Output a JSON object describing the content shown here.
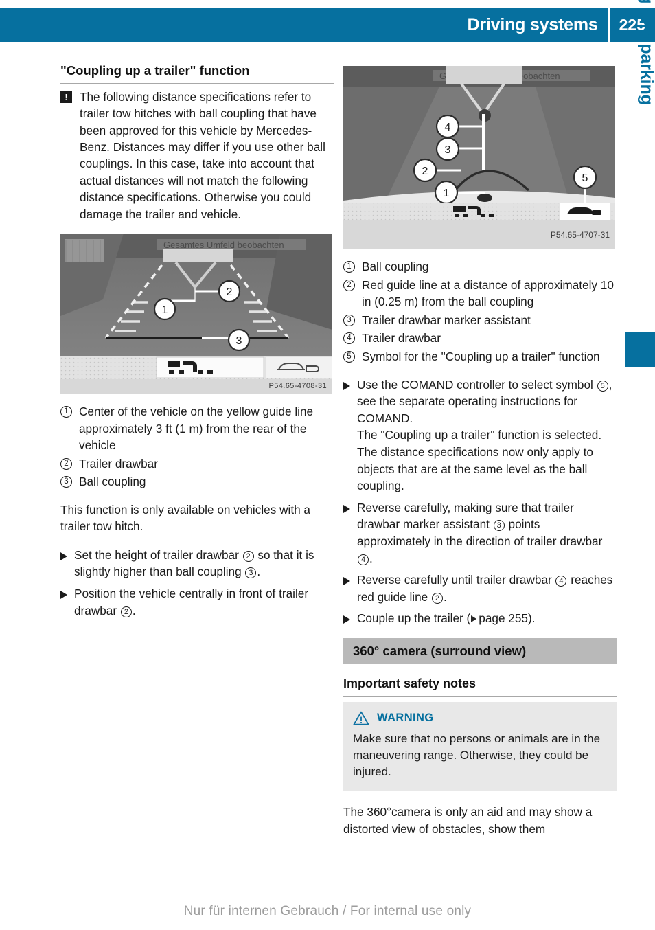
{
  "header": {
    "title": "Driving systems",
    "page_number": "225"
  },
  "side_tab": {
    "label": "Driving and parking"
  },
  "footer": {
    "watermark": "Nur für internen Gebrauch / For internal use only"
  },
  "left_column": {
    "heading": "\"Coupling up a trailer\" function",
    "note": {
      "icon": "exclamation-box-icon",
      "text": "The following distance specifications refer to trailer tow hitches with ball coupling that have been approved for this vehicle by Mercedes-Benz. Distances may differ if you use other ball couplings. In this case, take into account that actual distances will not match the following distance specifications. Otherwise you could damage the trailer and vehicle."
    },
    "figure": {
      "caption": "P54.65-4708-31",
      "callouts": [
        "1",
        "2",
        "3"
      ]
    },
    "legend": [
      {
        "num": "1",
        "text": "Center of the vehicle on the yellow guide line approximately 3 ft (1 m) from the rear of the vehicle"
      },
      {
        "num": "2",
        "text": "Trailer drawbar"
      },
      {
        "num": "3",
        "text": "Ball coupling"
      }
    ],
    "paragraph": "This function is only available on vehicles with a trailer tow hitch.",
    "actions": [
      {
        "parts": [
          "Set the height of trailer drawbar ",
          "2",
          " so that it is slightly higher than ball coupling ",
          "3",
          "."
        ]
      },
      {
        "parts": [
          "Position the vehicle centrally in front of trailer drawbar ",
          "2",
          "."
        ]
      }
    ]
  },
  "right_column": {
    "figure": {
      "caption": "P54.65-4707-31",
      "callouts": [
        "1",
        "2",
        "3",
        "4",
        "5"
      ]
    },
    "legend": [
      {
        "num": "1",
        "text": "Ball coupling"
      },
      {
        "num": "2",
        "text": "Red guide line at a distance of approximately 10 in (0.25 m) from the ball coupling"
      },
      {
        "num": "3",
        "text": "Trailer drawbar marker assistant"
      },
      {
        "num": "4",
        "text": "Trailer drawbar"
      },
      {
        "num": "5",
        "text": "Symbol for the \"Coupling up a trailer\" function"
      }
    ],
    "actions": [
      {
        "id": "action-comand",
        "text_before": "Use the COMAND controller to select symbol ",
        "ref": "5",
        "text_after": ", see the separate operating instructions for COMAND.",
        "followup": "The \"Coupling up a trailer\" function is selected. The distance specifications now only apply to objects that are at the same level as the ball coupling."
      },
      {
        "id": "action-reverse-marker",
        "text_before": "Reverse carefully, making sure that trailer drawbar marker assistant ",
        "ref": "3",
        "text_mid": " points approximately in the direction of trailer drawbar ",
        "ref2": "4",
        "text_after": "."
      },
      {
        "id": "action-reverse-until",
        "text_before": "Reverse carefully until trailer drawbar ",
        "ref": "4",
        "text_mid": " reaches red guide line ",
        "ref2": "2",
        "text_after": "."
      },
      {
        "id": "action-couple-up",
        "text_before": "Couple up the trailer (",
        "xref": "page 255",
        "text_after": ")."
      }
    ],
    "section": {
      "band_heading": "360° camera (surround view)",
      "minor_heading": "Important safety notes",
      "warning": {
        "icon": "warning-triangle-icon",
        "label": "WARNING",
        "body": "Make sure that no persons or animals are in the maneuvering range. Otherwise, they could be injured."
      },
      "closing_paragraph": "The 360°camera is only an aid and may show a distorted view of obstacles, show them"
    }
  },
  "colors": {
    "brand_blue": "#06709f",
    "band_gray": "#b9b9b9",
    "warning_gray": "#e8e8e8"
  }
}
